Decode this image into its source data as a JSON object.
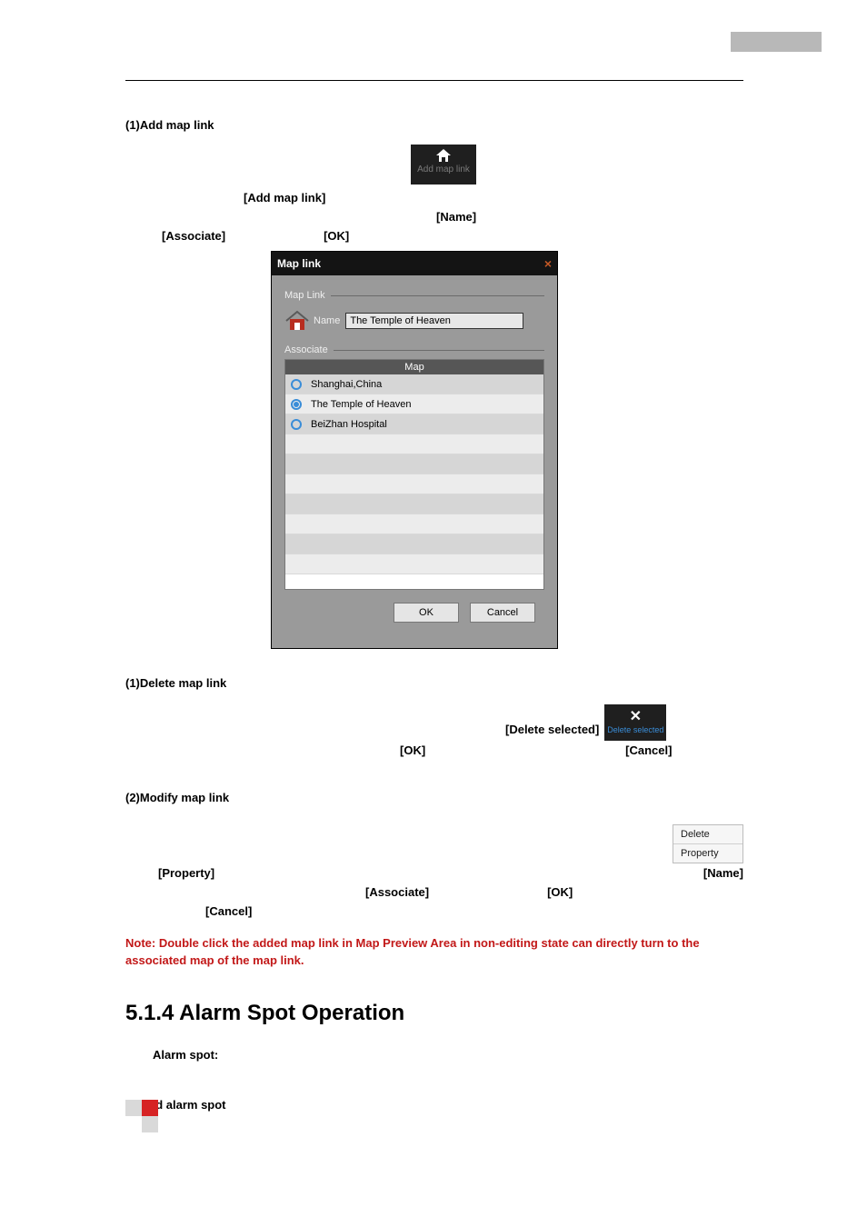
{
  "section1": {
    "heading": "(1)Add map link",
    "tb_btn_label": "Add map link",
    "br1": "[Add map link]",
    "br2": "[Name]",
    "br3": "[Associate]",
    "br4": "[OK]"
  },
  "dialog": {
    "title": "Map link",
    "group1": "Map Link",
    "name_label": "Name",
    "name_value": "The Temple of Heaven",
    "group2": "Associate",
    "col": "Map",
    "rows": [
      {
        "label": "Shanghai,China",
        "selected": false
      },
      {
        "label": "The Temple of Heaven",
        "selected": true
      },
      {
        "label": "BeiZhan Hospital",
        "selected": false
      }
    ],
    "ok": "OK",
    "cancel": "Cancel"
  },
  "section2": {
    "heading": "(1)Delete map link",
    "br_del": "[Delete selected]",
    "br_ok": "[OK]",
    "br_cancel": "[Cancel]",
    "del_btn_label": "Delete selected"
  },
  "section3": {
    "heading": "(2)Modify map link",
    "ctx_delete": "Delete",
    "ctx_property": "Property",
    "br_prop": "[Property]",
    "br_name": "[Name]",
    "br_assoc": "[Associate]",
    "br_ok": "[OK]",
    "br_cancel": "[Cancel]"
  },
  "note": "Note: Double click the added map link in Map Preview Area in non-editing state can directly turn to the associated map of the map link.",
  "h2": "5.1.4 Alarm Spot Operation",
  "alarm_spot_label": "Alarm spot:",
  "section4": {
    "heading": "(1)Add alarm spot"
  }
}
